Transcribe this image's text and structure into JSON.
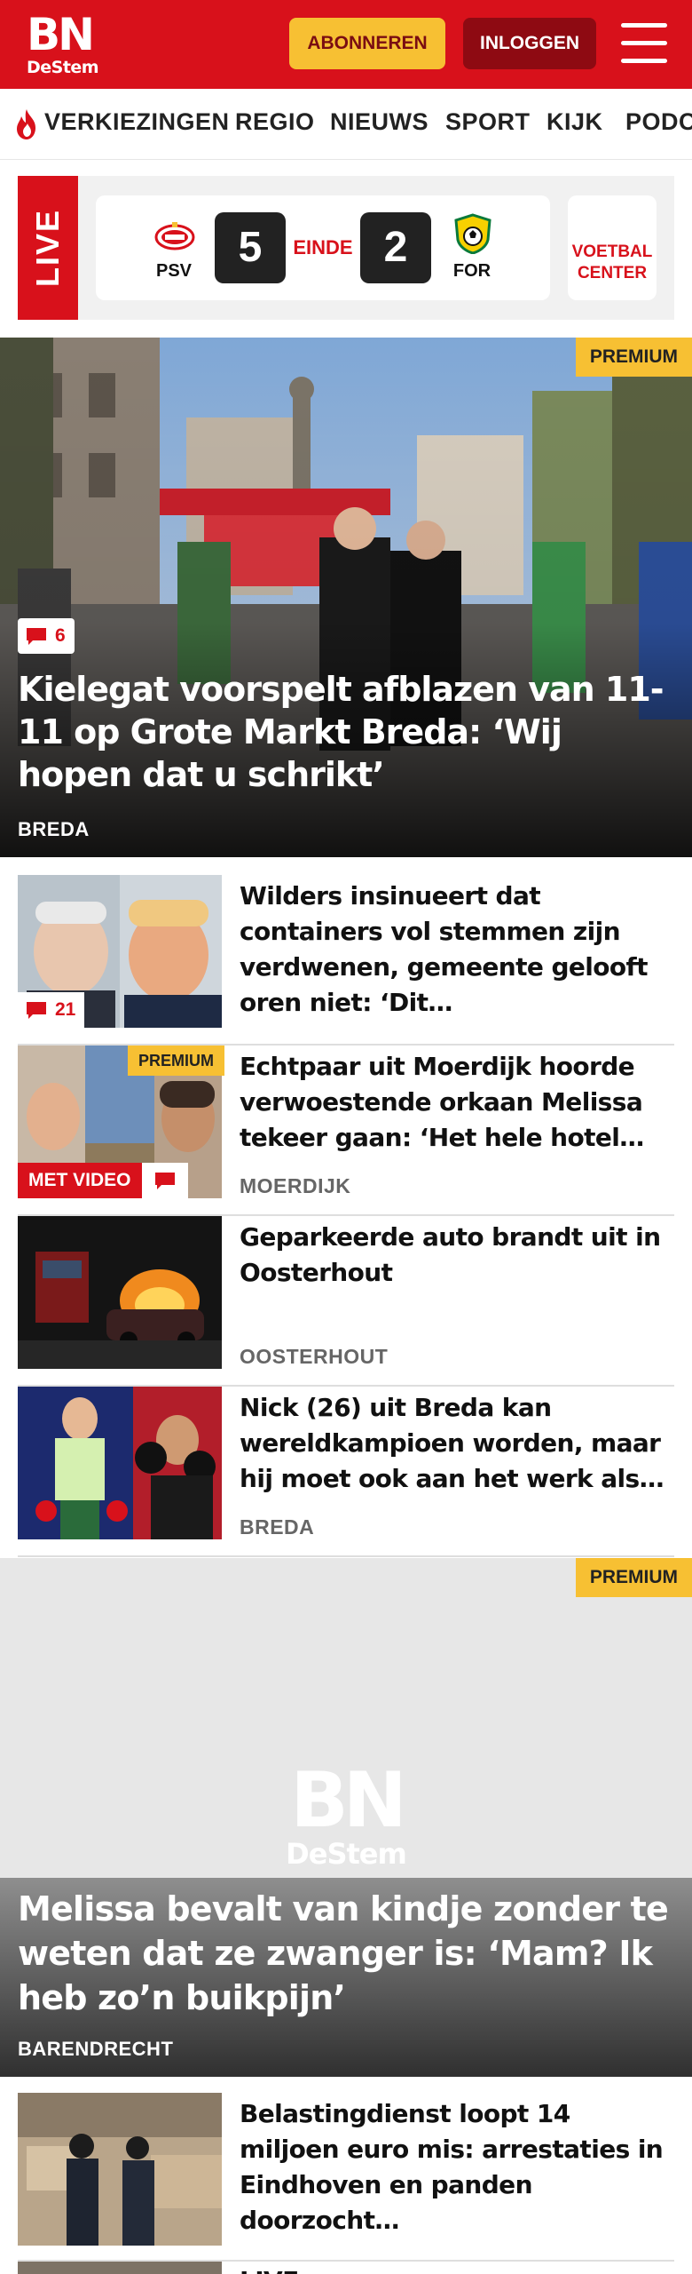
{
  "header": {
    "logo_main": "BN",
    "logo_sub": "DeStem",
    "subscribe_label": "ABONNEREN",
    "login_label": "INLOGGEN",
    "brand_color": "#d8111b"
  },
  "nav": {
    "items": [
      "VERKIEZINGEN",
      "REGIO",
      "NIEUWS",
      "SPORT",
      "KIJK",
      "PODC"
    ]
  },
  "live": {
    "label": "LIVE",
    "home_team": "PSV",
    "home_score": "5",
    "status": "EINDE",
    "away_score": "2",
    "away_team": "FOR",
    "center_line1": "VOETBAL",
    "center_line2": "CENTER"
  },
  "hero": {
    "premium": "PREMIUM",
    "comments": "6",
    "title": "Kielegat voorspelt afblazen van 11-11 op Grote Markt Breda: ‘Wij hopen dat u schrikt’",
    "place": "BREDA"
  },
  "articles": [
    {
      "title": "Wilders insinueert dat containers vol stemmen zijn verdwenen, gemeente gelooft oren niet: ‘Dit…",
      "comments": "21",
      "place": ""
    },
    {
      "title": "Echtpaar uit Moerdijk hoorde verwoestende orkaan Melissa tekeer gaan: ‘Het hele hotel…",
      "premium": "PREMIUM",
      "video": "MET VIDEO",
      "place": "MOERDIJK"
    },
    {
      "title": "Geparkeerde auto brandt uit in Oosterhout",
      "place": "OOSTERHOUT"
    },
    {
      "title": "Nick (26) uit Breda kan wereldkampioen worden, maar hij moet ook aan het werk als…",
      "place": "BREDA"
    }
  ],
  "big_article": {
    "premium": "PREMIUM",
    "watermark_main": "BN",
    "watermark_sub": "DeStem",
    "title": "Melissa bevalt van kindje zonder te weten dat ze zwanger is: ‘Mam? Ik heb zo’n buikpijn’",
    "place": "BARENDRECHT"
  },
  "article_after": {
    "title": "Belastingdienst loopt 14 miljoen euro mis: arrestaties in Eindhoven en panden doorzocht…"
  },
  "article_cut": {
    "title": "LIVE"
  }
}
